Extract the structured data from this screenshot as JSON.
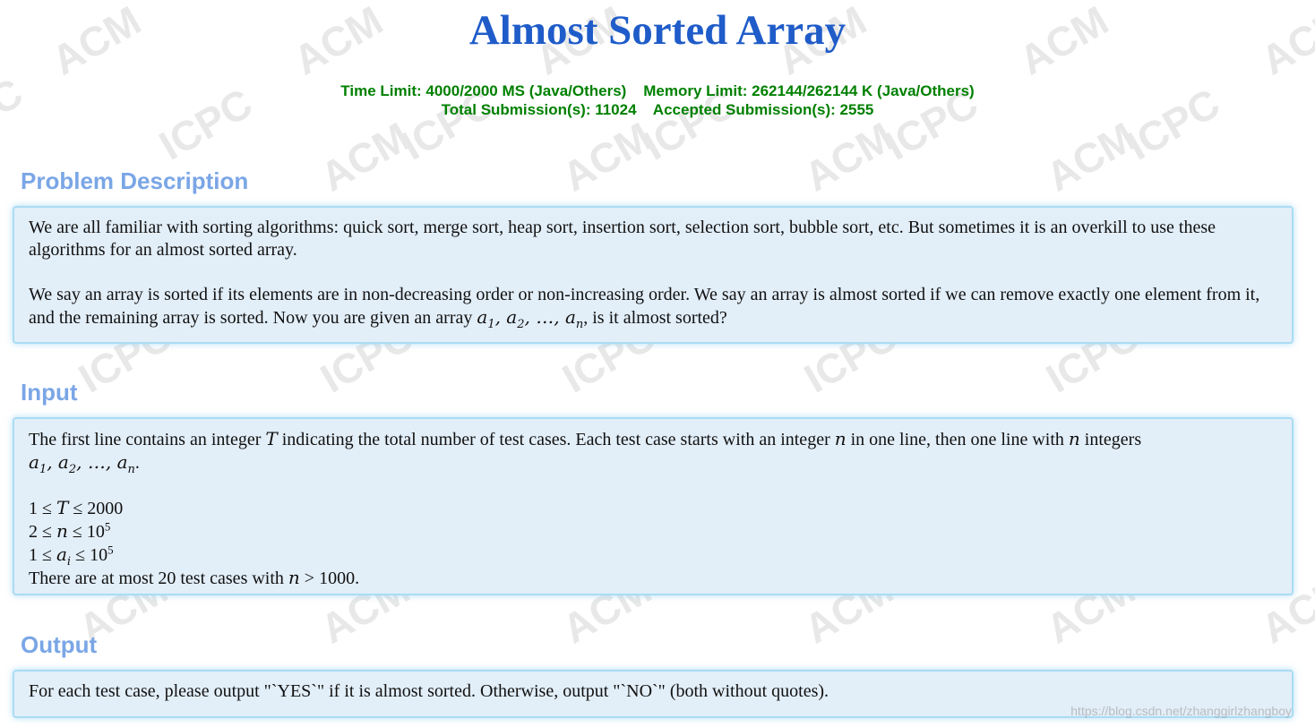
{
  "problem": {
    "title": "Almost Sorted Array",
    "limits_line1": "Time Limit: 4000/2000 MS (Java/Others)    Memory Limit: 262144/262144 K (Java/Others)",
    "limits_line2": "Total Submission(s): 11024    Accepted Submission(s): 2555"
  },
  "sections": {
    "description": {
      "heading": "Problem Description",
      "para1": "We are all familiar with sorting algorithms: quick sort, merge sort, heap sort, insertion sort, selection sort, bubble sort, etc. But sometimes it is an overkill to use these algorithms for an almost sorted array.",
      "para2_text": "We say an array is sorted if its elements are in non-decreasing order or non-increasing order. We say an array is almost sorted if we can remove exactly one element from it, and the remaining array is sorted. Now you are given an array ",
      "para2_tail": ", is it almost sorted?"
    },
    "input": {
      "heading": "Input",
      "line1_a": "The first line contains an integer ",
      "line1_b": " indicating the total number of test cases. Each test case starts with an integer ",
      "line1_c": " in one line, then one line with ",
      "line1_d": " integers",
      "constraint_tail_a": "There are at most 20 test cases with ",
      "constraint_tail_b": "."
    },
    "output": {
      "heading": "Output",
      "text": "For each test case, please output \"`YES`\" if it is almost sorted. Otherwise, output \"`NO`\" (both without quotes)."
    }
  },
  "watermark": {
    "url": "https://blog.csdn.net/zhanggirlzhangboy",
    "text1": "ACM",
    "text2": "ICPC"
  }
}
